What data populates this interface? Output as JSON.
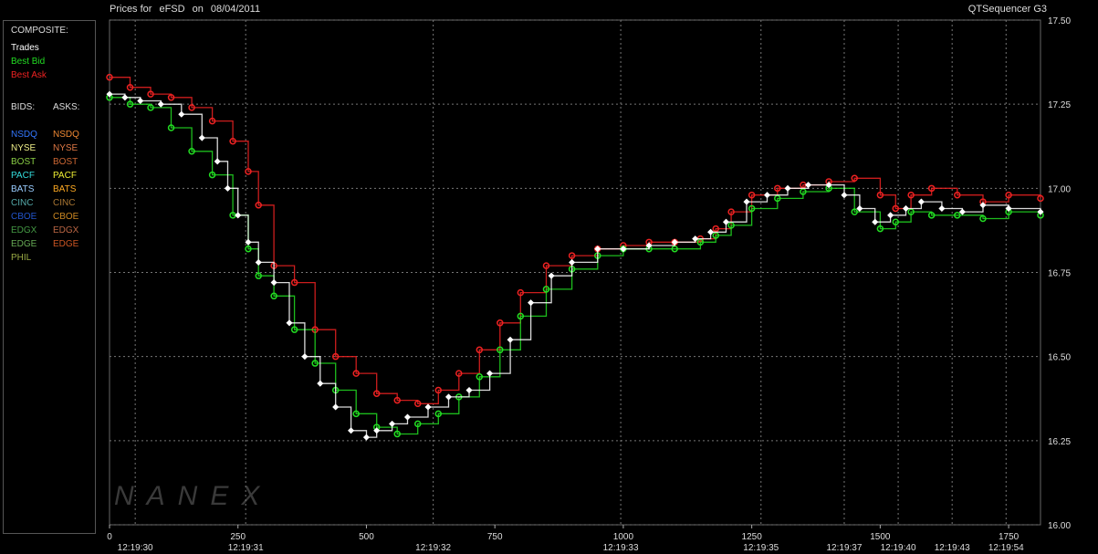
{
  "header": {
    "title_prefix": "Prices for",
    "symbol": "eFSD",
    "date_prefix": "on",
    "date": "08/04/2011",
    "app_name": "QTSequencer G3"
  },
  "watermark": "NANEX",
  "legend": {
    "composite_heading": "COMPOSITE:",
    "composite": [
      {
        "label": "Trades",
        "color": "#ffffff"
      },
      {
        "label": "Best Bid",
        "color": "#22dd22"
      },
      {
        "label": "Best Ask",
        "color": "#ee2222"
      }
    ],
    "bids_heading": "BIDS:",
    "asks_heading": "ASKS:",
    "bids": [
      {
        "label": "NSDQ",
        "color": "#3377ff"
      },
      {
        "label": "NYSE",
        "color": "#eeee88"
      },
      {
        "label": "BOST",
        "color": "#88cc44"
      },
      {
        "label": "PACF",
        "color": "#33dddd"
      },
      {
        "label": "BATS",
        "color": "#99ccff"
      },
      {
        "label": "CINC",
        "color": "#55aaaa"
      },
      {
        "label": "CBOE",
        "color": "#2255cc"
      },
      {
        "label": "EDGX",
        "color": "#449944"
      },
      {
        "label": "EDGE",
        "color": "#66aa55"
      },
      {
        "label": "PHIL",
        "color": "#99aa44"
      }
    ],
    "asks": [
      {
        "label": "NSDQ",
        "color": "#ee8833"
      },
      {
        "label": "NYSE",
        "color": "#dd7744"
      },
      {
        "label": "BOST",
        "color": "#cc6633"
      },
      {
        "label": "PACF",
        "color": "#eeee33"
      },
      {
        "label": "BATS",
        "color": "#ffaa22"
      },
      {
        "label": "CINC",
        "color": "#aa7733"
      },
      {
        "label": "CBOE",
        "color": "#cc8822"
      },
      {
        "label": "EDGX",
        "color": "#bb6644"
      },
      {
        "label": "EDGE",
        "color": "#cc5522"
      }
    ]
  },
  "chart_data": {
    "type": "line",
    "title": "Prices for eFSD on 08/04/2011",
    "xlabel": "",
    "ylabel": "",
    "ylim": [
      16.0,
      17.5
    ],
    "xlim": [
      0,
      1812
    ],
    "y_ticks": [
      16.0,
      16.25,
      16.5,
      16.75,
      17.0,
      17.25,
      17.5
    ],
    "y_tick_labels": [
      "16.00",
      "16.25",
      "16.50",
      "16.75",
      "17.00",
      "17.25",
      "17.50"
    ],
    "x_ticks": [
      0,
      250,
      500,
      750,
      1000,
      1250,
      1500,
      1750
    ],
    "x_tick_labels": [
      "0",
      "250",
      "500",
      "750",
      "1000",
      "1250",
      "1500",
      "1750"
    ],
    "time_ticks": [
      {
        "x": 50,
        "label": "12:19:30"
      },
      {
        "x": 265,
        "label": "12:19:31"
      },
      {
        "x": 630,
        "label": "12:19:32"
      },
      {
        "x": 995,
        "label": "12:19:33"
      },
      {
        "x": 1268,
        "label": "12:19:35"
      },
      {
        "x": 1430,
        "label": "12:19:37"
      },
      {
        "x": 1535,
        "label": "12:19:40"
      },
      {
        "x": 1640,
        "label": "12:19:43"
      },
      {
        "x": 1745,
        "label": "12:19:54"
      }
    ],
    "grid": true,
    "series": [
      {
        "name": "Best Ask",
        "color": "#ee2222",
        "points": [
          [
            0,
            17.33
          ],
          [
            40,
            17.3
          ],
          [
            80,
            17.28
          ],
          [
            120,
            17.27
          ],
          [
            160,
            17.24
          ],
          [
            200,
            17.2
          ],
          [
            240,
            17.14
          ],
          [
            270,
            17.05
          ],
          [
            290,
            16.95
          ],
          [
            320,
            16.77
          ],
          [
            360,
            16.72
          ],
          [
            400,
            16.58
          ],
          [
            440,
            16.5
          ],
          [
            480,
            16.45
          ],
          [
            520,
            16.39
          ],
          [
            560,
            16.37
          ],
          [
            600,
            16.36
          ],
          [
            640,
            16.4
          ],
          [
            680,
            16.45
          ],
          [
            720,
            16.52
          ],
          [
            760,
            16.6
          ],
          [
            800,
            16.69
          ],
          [
            850,
            16.77
          ],
          [
            900,
            16.8
          ],
          [
            950,
            16.82
          ],
          [
            1000,
            16.83
          ],
          [
            1050,
            16.84
          ],
          [
            1100,
            16.84
          ],
          [
            1150,
            16.85
          ],
          [
            1180,
            16.88
          ],
          [
            1210,
            16.93
          ],
          [
            1250,
            16.98
          ],
          [
            1300,
            17.0
          ],
          [
            1350,
            17.01
          ],
          [
            1400,
            17.02
          ],
          [
            1450,
            17.03
          ],
          [
            1500,
            16.98
          ],
          [
            1530,
            16.94
          ],
          [
            1560,
            16.98
          ],
          [
            1600,
            17.0
          ],
          [
            1650,
            16.98
          ],
          [
            1700,
            16.96
          ],
          [
            1750,
            16.98
          ],
          [
            1812,
            16.97
          ]
        ]
      },
      {
        "name": "Best Bid",
        "color": "#22dd22",
        "points": [
          [
            0,
            17.27
          ],
          [
            40,
            17.25
          ],
          [
            80,
            17.24
          ],
          [
            120,
            17.18
          ],
          [
            160,
            17.11
          ],
          [
            200,
            17.04
          ],
          [
            240,
            16.92
          ],
          [
            270,
            16.82
          ],
          [
            290,
            16.74
          ],
          [
            320,
            16.68
          ],
          [
            360,
            16.58
          ],
          [
            400,
            16.48
          ],
          [
            440,
            16.4
          ],
          [
            480,
            16.33
          ],
          [
            520,
            16.29
          ],
          [
            560,
            16.27
          ],
          [
            600,
            16.3
          ],
          [
            640,
            16.33
          ],
          [
            680,
            16.38
          ],
          [
            720,
            16.44
          ],
          [
            760,
            16.52
          ],
          [
            800,
            16.62
          ],
          [
            850,
            16.7
          ],
          [
            900,
            16.76
          ],
          [
            950,
            16.8
          ],
          [
            1000,
            16.82
          ],
          [
            1050,
            16.82
          ],
          [
            1100,
            16.82
          ],
          [
            1150,
            16.84
          ],
          [
            1180,
            16.86
          ],
          [
            1210,
            16.89
          ],
          [
            1250,
            16.94
          ],
          [
            1300,
            16.97
          ],
          [
            1350,
            16.99
          ],
          [
            1400,
            17.0
          ],
          [
            1450,
            16.93
          ],
          [
            1500,
            16.88
          ],
          [
            1530,
            16.9
          ],
          [
            1560,
            16.93
          ],
          [
            1600,
            16.92
          ],
          [
            1650,
            16.92
          ],
          [
            1700,
            16.91
          ],
          [
            1750,
            16.93
          ],
          [
            1812,
            16.92
          ]
        ]
      },
      {
        "name": "Trades",
        "color": "#ffffff",
        "points": [
          [
            0,
            17.28
          ],
          [
            30,
            17.27
          ],
          [
            60,
            17.26
          ],
          [
            100,
            17.25
          ],
          [
            140,
            17.22
          ],
          [
            180,
            17.15
          ],
          [
            210,
            17.08
          ],
          [
            230,
            17.0
          ],
          [
            250,
            16.92
          ],
          [
            270,
            16.84
          ],
          [
            290,
            16.78
          ],
          [
            320,
            16.72
          ],
          [
            350,
            16.6
          ],
          [
            380,
            16.5
          ],
          [
            410,
            16.42
          ],
          [
            440,
            16.35
          ],
          [
            470,
            16.28
          ],
          [
            500,
            16.26
          ],
          [
            520,
            16.28
          ],
          [
            550,
            16.3
          ],
          [
            580,
            16.32
          ],
          [
            620,
            16.35
          ],
          [
            660,
            16.38
          ],
          [
            700,
            16.4
          ],
          [
            740,
            16.45
          ],
          [
            780,
            16.55
          ],
          [
            820,
            16.66
          ],
          [
            860,
            16.74
          ],
          [
            900,
            16.78
          ],
          [
            950,
            16.82
          ],
          [
            1000,
            16.82
          ],
          [
            1050,
            16.83
          ],
          [
            1100,
            16.84
          ],
          [
            1140,
            16.85
          ],
          [
            1170,
            16.87
          ],
          [
            1200,
            16.9
          ],
          [
            1240,
            16.96
          ],
          [
            1280,
            16.98
          ],
          [
            1320,
            17.0
          ],
          [
            1360,
            17.01
          ],
          [
            1400,
            17.01
          ],
          [
            1430,
            16.98
          ],
          [
            1460,
            16.94
          ],
          [
            1490,
            16.9
          ],
          [
            1520,
            16.92
          ],
          [
            1550,
            16.94
          ],
          [
            1580,
            16.96
          ],
          [
            1620,
            16.94
          ],
          [
            1660,
            16.93
          ],
          [
            1700,
            16.95
          ],
          [
            1750,
            16.94
          ],
          [
            1812,
            16.93
          ]
        ]
      }
    ]
  }
}
